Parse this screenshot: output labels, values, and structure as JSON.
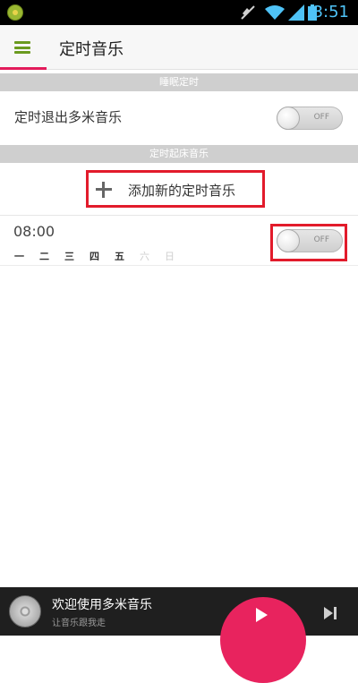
{
  "status_bar": {
    "time": "3:51",
    "icons": [
      "app-notification-icon",
      "mute-icon",
      "wifi-icon",
      "signal-icon",
      "battery-icon"
    ]
  },
  "header": {
    "title": "定时音乐"
  },
  "sleep_section": {
    "header": "睡眠定时",
    "exit_label": "定时退出多米音乐",
    "exit_toggle": "OFF"
  },
  "wake_section": {
    "header": "定时起床音乐",
    "add_label": "添加新的定时音乐",
    "alarm": {
      "time": "08:00",
      "toggle": "OFF",
      "days": [
        {
          "label": "一",
          "active": true
        },
        {
          "label": "二",
          "active": true
        },
        {
          "label": "三",
          "active": true
        },
        {
          "label": "四",
          "active": true
        },
        {
          "label": "五",
          "active": true
        },
        {
          "label": "六",
          "active": false
        },
        {
          "label": "日",
          "active": false
        }
      ]
    }
  },
  "player": {
    "title": "欢迎使用多米音乐",
    "subtitle": "让音乐跟我走"
  },
  "colors": {
    "accent": "#e31b5b",
    "menu_green": "#6a9a1f",
    "highlight_red": "#e21b2b"
  }
}
